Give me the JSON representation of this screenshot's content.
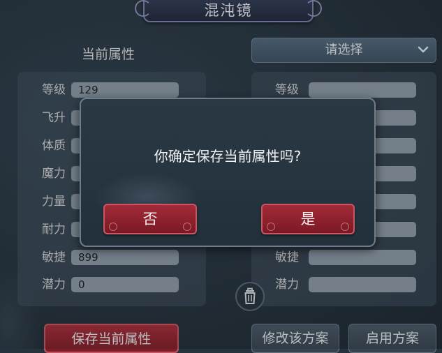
{
  "window": {
    "title": "混沌镜"
  },
  "left": {
    "title": "当前属性",
    "stats": [
      {
        "label": "等级",
        "value": "129"
      },
      {
        "label": "飞升",
        "value": ""
      },
      {
        "label": "体质",
        "value": ""
      },
      {
        "label": "魔力",
        "value": ""
      },
      {
        "label": "力量",
        "value": ""
      },
      {
        "label": "耐力",
        "value": ""
      },
      {
        "label": "敏捷",
        "value": "899"
      },
      {
        "label": "潜力",
        "value": "0"
      }
    ],
    "save_button": "保存当前属性"
  },
  "right": {
    "dropdown_label": "请选择",
    "stats": [
      {
        "label": "等级",
        "value": ""
      },
      {
        "label": "",
        "value": ""
      },
      {
        "label": "",
        "value": ""
      },
      {
        "label": "",
        "value": ""
      },
      {
        "label": "",
        "value": ""
      },
      {
        "label": "",
        "value": ""
      },
      {
        "label": "敏捷",
        "value": ""
      },
      {
        "label": "潜力",
        "value": ""
      }
    ],
    "modify_button": "修改该方案",
    "enable_button": "启用方案"
  },
  "dialog": {
    "message": "你确定保存当前属性吗?",
    "no_label": "否",
    "yes_label": "是"
  },
  "icons": [
    "chevron-down-icon",
    "trash-icon"
  ],
  "colors": {
    "accent_red": "#a52e3b",
    "field_gray": "#8c98a4",
    "background": "#26323e"
  }
}
